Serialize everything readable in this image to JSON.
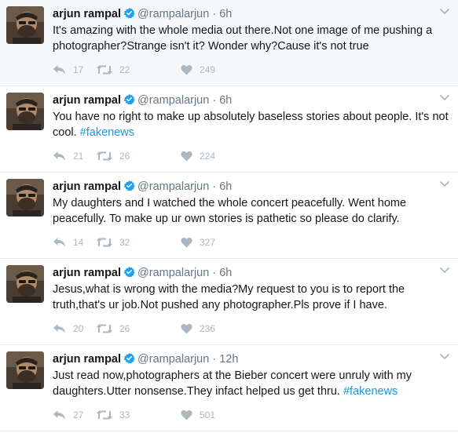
{
  "colors": {
    "name": "#14171a",
    "meta": "#657786",
    "hashtag": "#1b95e0",
    "verified": "#1da1f2",
    "action": "#aab8c2",
    "first_tweet_background": "#f5f8fa",
    "divider": "#e6ecf0"
  },
  "icons": {
    "verified": "verified-badge-icon",
    "menu": "chevron-down-icon",
    "reply": "reply-icon",
    "retweet": "retweet-icon",
    "like": "heart-icon"
  },
  "tweets": [
    {
      "name": "arjun rampal",
      "handle": "@rampalarjun",
      "dot": "·",
      "time": "6h",
      "text": "It's amazing with the whole media out there.Not one image of me pushing a photographer?Strange isn't it? Wonder why?Cause it's not true",
      "hashtag": "",
      "replies": "17",
      "retweets": "22",
      "likes": "249"
    },
    {
      "name": "arjun rampal",
      "handle": "@rampalarjun",
      "dot": "·",
      "time": "6h",
      "text": "You have no right to make up absolutely baseless stories about people. It's not cool. ",
      "hashtag": "#fakenews",
      "replies": "21",
      "retweets": "26",
      "likes": "224"
    },
    {
      "name": "arjun rampal",
      "handle": "@rampalarjun",
      "dot": "·",
      "time": "6h",
      "text": "My daughters and I watched the whole concert peacefully. Went home peacefully. To make up ur own stories is pathetic so please do clarify.",
      "hashtag": "",
      "replies": "14",
      "retweets": "32",
      "likes": "327"
    },
    {
      "name": "arjun rampal",
      "handle": "@rampalarjun",
      "dot": "·",
      "time": "6h",
      "text": "Jesus,what is wrong with the media?My request to you is to report the truth,that's ur job.Not pushed any photographer.Pls prove if I have.",
      "hashtag": "",
      "replies": "20",
      "retweets": "26",
      "likes": "236"
    },
    {
      "name": "arjun rampal",
      "handle": "@rampalarjun",
      "dot": "·",
      "time": "12h",
      "text": "Just read now,photographers at the Bieber concert were unruly with my daughters.Utter nonsense.They infact helped us get thru. ",
      "hashtag": "#fakenews",
      "replies": "27",
      "retweets": "33",
      "likes": "501"
    }
  ]
}
